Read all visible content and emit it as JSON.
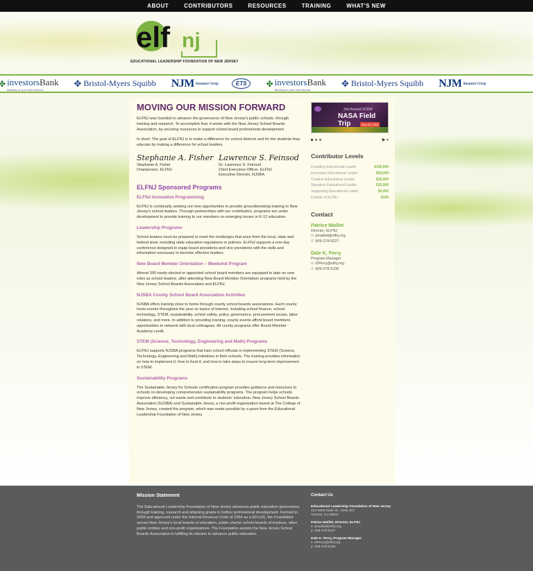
{
  "nav": {
    "items": [
      "ABOUT",
      "CONTRIBUTORS",
      "RESOURCES",
      "TRAINING",
      "WHAT'S NEW"
    ]
  },
  "logo": {
    "text": "elfnj",
    "subtitle": "EDUCATIONAL LEADERSHIP FOUNDATION OF NEW JERSEY"
  },
  "sponsors": [
    {
      "name": "investors",
      "name2": "Bank",
      "tag": "Banking on your best interest."
    },
    {
      "name": "Bristol-Myers Squibb"
    },
    {
      "name": "NJM",
      "name2": "Insurance Group"
    },
    {
      "name": "ETS"
    },
    {
      "name": "investors",
      "name2": "Bank",
      "tag": "Banking on your best interest."
    },
    {
      "name": "Bristol-Myers Squibb"
    },
    {
      "name": "NJM",
      "name2": "Insurance Group"
    }
  ],
  "main": {
    "title": "MOVING OUR MISSION FORWARD",
    "intro": "ELFNJ was founded to advance the governance of New Jersey's public schools, through training and research. To accomplish that, it works with the New Jersey School Boards Association, by securing resources to support school board professional development.",
    "short": "In short: The goal of ELFNJ is to make a difference for school districts and for the students they educate by making a difference for school leaders.",
    "sig1": {
      "mark": "Stephanie A. Fisher",
      "name": "Stephanie A. Fisher",
      "role": "Chairperson, ELFNJ"
    },
    "sig2": {
      "mark": "Lawrence S. Feinsod",
      "name": "Dr. Lawrence S. Feinsod",
      "role": "Chief Executive Officer, ELFNJ",
      "role2": "Executive Director, NJSBA"
    },
    "programs_heading": "ELFNJ Sponsored Programs",
    "programs": [
      {
        "title": "ELFNJ Innovative Programming",
        "text": "ELFNJ is continually seeking out new opportunities to provide groundbreaking training to New Jersey's school leaders. Through partnerships with our contributors, programs are under development to provide training to our members on emerging issues in K-12 education."
      },
      {
        "title": "Leadership Programs",
        "text": "School leaders must be prepared to meet the challenges that arise from the local, state and federal level, including state education regulations or policies. ELFNJ supports a one-day conference designed to equip board presidents and vice presidents with the skills and information necessary to become effective leaders."
      },
      {
        "title": "New Board Member Orientation – Weekend Program",
        "text": "Almost 300 newly-elected or appointed school board members are equipped to take on new roles as school leaders, after attending New Board Member Orientation programs held by the New Jersey School Boards Association and ELFNJ."
      },
      {
        "title": "NJSBA County School Board Association Activities",
        "text": "NJSBA offers training close to home through county school boards associations. Each county hosts events throughout the year on topics of interest, including school finance, school technology, STEM, sustainability, school safety, policy, governance, procurement issues, labor relations, and more. In addition to providing training, county events afford board members opportunities to network with local colleagues. All county programs offer Board Member Academy credit."
      },
      {
        "title": "STEM (Science, Technology, Engineering and Math) Programs",
        "text": "ELFNJ supports NJSBA programs that train school officials in implementing STEM (Science, Technology, Engineering and Math) initiatives in their schools. The training provides information on how to implement it; how to fund it; and how to take steps to ensure long-term improvement in STEM."
      },
      {
        "title": "Sustainability Programs",
        "text": "The Sustainable Jersey for Schools certification program provides guidance and resources to schools on developing comprehensive sustainability programs. The program helps schools improve efficiency, cut waste and contribute to students' education. New Jersey School Boards Association (NJSBA) and Sustainable Jersey, a non-profit organization based at The College of New Jersey, created the program, which was made possible by a grant from the Educational Leadership Foundation of New Jersey."
      }
    ]
  },
  "sidebar": {
    "slide": {
      "line1": "2nd Annual iSTEM",
      "line2": "NASA Field Trip",
      "tag": "May 30, 2015"
    },
    "contributor_heading": "Contributor Levels",
    "levels": [
      {
        "name": "Founding Educational Leader",
        "amount": "$100,000"
      },
      {
        "name": "Innovative Educational Leader",
        "amount": "$50,000"
      },
      {
        "name": "Creative Educational Leader",
        "amount": "$20,000"
      },
      {
        "name": "Signature Educational Leader",
        "amount": "$10,000"
      },
      {
        "name": "Supporting Educational Leader",
        "amount": "$5,000"
      },
      {
        "name": "Friends of ELFNJ",
        "amount": "$100"
      }
    ],
    "contact_heading": "Contact",
    "contacts": [
      {
        "name": "Patrice Maillet",
        "title": "Director, ELFNJ",
        "email": "pmaillet@elfnj.org",
        "phone": "609-278-5227"
      },
      {
        "name": "Dale K. Perry",
        "title": "Program Manager",
        "email": "DPerry@elfnj.org",
        "phone": "609-278-5238"
      }
    ]
  },
  "footer": {
    "mission_heading": "Mission Statement",
    "mission_text": "The Educational Leadership Foundation of New Jersey advances public education governance through training, research and attaining grants to further professional development. Formed in 2008 and approved under the Internal Revenue Code of 1954 as a 501c(3), the Foundation serves New Jersey's local boards of education, public charter school boards of trustees, other public entities and non-profit organizations. The Foundation assists the New Jersey School Boards Association in fulfilling its mission to advance public education.",
    "contact_heading": "Contact Us",
    "org_name": "Educational Leadership Foundation of New Jersey",
    "address1": "413 West State St., Suite 207",
    "address2": "Trenton, NJ 08618",
    "c1_name": "Patrice Maillet, Director, ELFNJ",
    "c1_email": "e. pmaillet@elfnj.org",
    "c1_phone": "p. 609-278-5227",
    "c2_name": "Dale K. Perry, Program Manager",
    "c2_email": "e. DPerry@elfnj.org",
    "c2_phone": "p. 609-278-5238"
  },
  "colors": {
    "purple": "#5e2a6b",
    "green": "#7cb342",
    "footer": "#5a5b5c"
  }
}
